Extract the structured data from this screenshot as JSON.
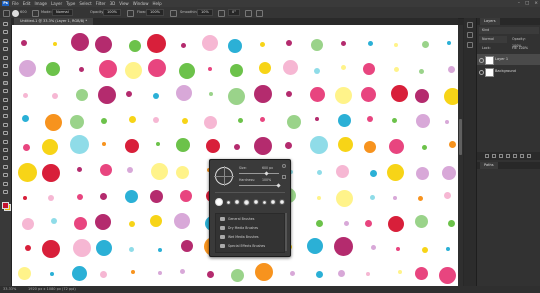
{
  "menubar": {
    "logo": "Ps",
    "items": [
      "File",
      "Edit",
      "Image",
      "Layer",
      "Type",
      "Select",
      "Filter",
      "3D",
      "View",
      "Window",
      "Help"
    ],
    "window_controls": [
      "–",
      "□",
      "×"
    ]
  },
  "options_bar": {
    "brush_size": "600",
    "mode_label": "Mode:",
    "mode_value": "Normal",
    "opacity_label": "Opacity:",
    "opacity_value": "100%",
    "flow_label": "Flow:",
    "flow_value": "100%",
    "smoothing_label": "Smoothing:",
    "smoothing_value": "10%",
    "angle_value": "0°"
  },
  "document_tab": {
    "label": "Untitled-1 @ 33.3% (Layer 1, RGB/8) *"
  },
  "brush_popup": {
    "size_label": "Size:",
    "size_value": "600 px",
    "hardness_label": "Hardness:",
    "hardness_value": "100%",
    "folders": [
      "General Brushes",
      "Dry Media Brushes",
      "Wet Media Brushes",
      "Special Effects Brushes"
    ]
  },
  "layers_panel": {
    "tab_label": "Layers",
    "kind_label": "Kind",
    "blend_mode": "Normal",
    "opacity_label": "Opacity:",
    "opacity_value": "100%",
    "lock_label": "Lock:",
    "fill_label": "Fill:",
    "fill_value": "100%",
    "layers": [
      {
        "name": "Layer 1"
      },
      {
        "name": "Background"
      }
    ]
  },
  "paths_panel": {
    "tab_label": "Paths"
  },
  "status_bar": {
    "zoom": "33.33%",
    "doc_info": "1920 px x 1080 px (72 ppi)"
  },
  "colors": {
    "foreground": "#c3102f",
    "background": "#e9b70a",
    "dot_palette": [
      "#e8457f",
      "#6cc24a",
      "#2bb0d6",
      "#f7931e",
      "#f7d417",
      "#b42b6e",
      "#d81f3a",
      "#9ad38a",
      "#8fdce8",
      "#f6b7d3",
      "#fff38a",
      "#d8a8d8"
    ]
  }
}
